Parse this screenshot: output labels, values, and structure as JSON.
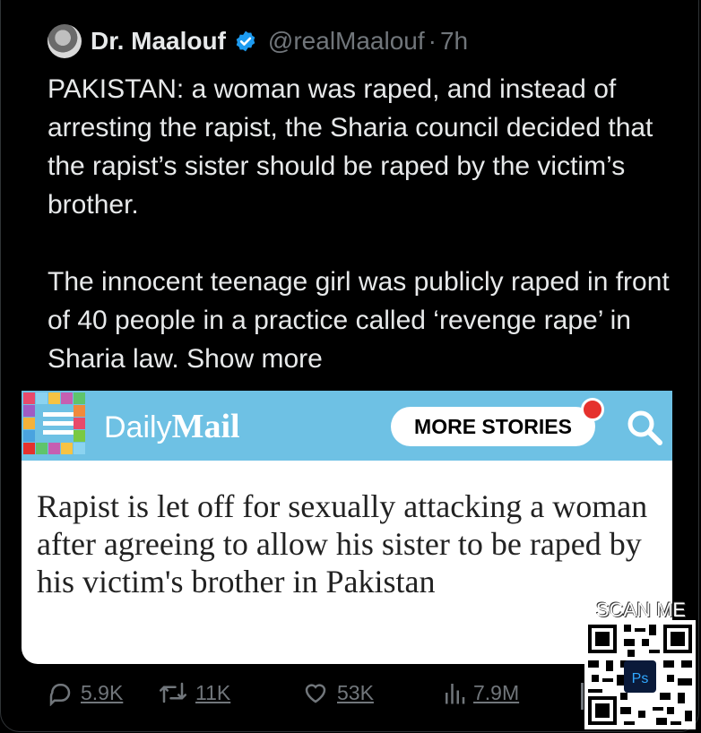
{
  "header": {
    "display_name": "Dr. Maalouf",
    "handle": "@realMaalouf",
    "separator": "·",
    "time": "7h"
  },
  "tweet": {
    "paragraphs": [
      "PAKISTAN: a woman was raped, and instead of arresting the rapist, the Sharia council decided that the rapist’s sister should be raped by the victim’s brother.",
      "The innocent teenage girl was publicly raped in front of 40 people in a practice called ‘revenge rape’ in Sharia law."
    ],
    "show_more": "Show more"
  },
  "media": {
    "brand_daily": "Daily",
    "brand_mail": "Mail",
    "more_stories": "MORE STORIES",
    "headline": "Rapist is let off for sexually attacking a woman after agreeing to allow his sister to be raped by his victim's brother in Pakistan",
    "bar_color": "#6ec1e4"
  },
  "actions": {
    "replies": "5.9K",
    "reposts": "11K",
    "likes": "53K",
    "views": "7.9M"
  },
  "watermark": {
    "label": "SCAN ME",
    "badge": "Ps"
  },
  "colors": {
    "background": "#000000",
    "text": "#e7e9ea",
    "muted": "#71767b",
    "verified": "#1d9bf0"
  }
}
